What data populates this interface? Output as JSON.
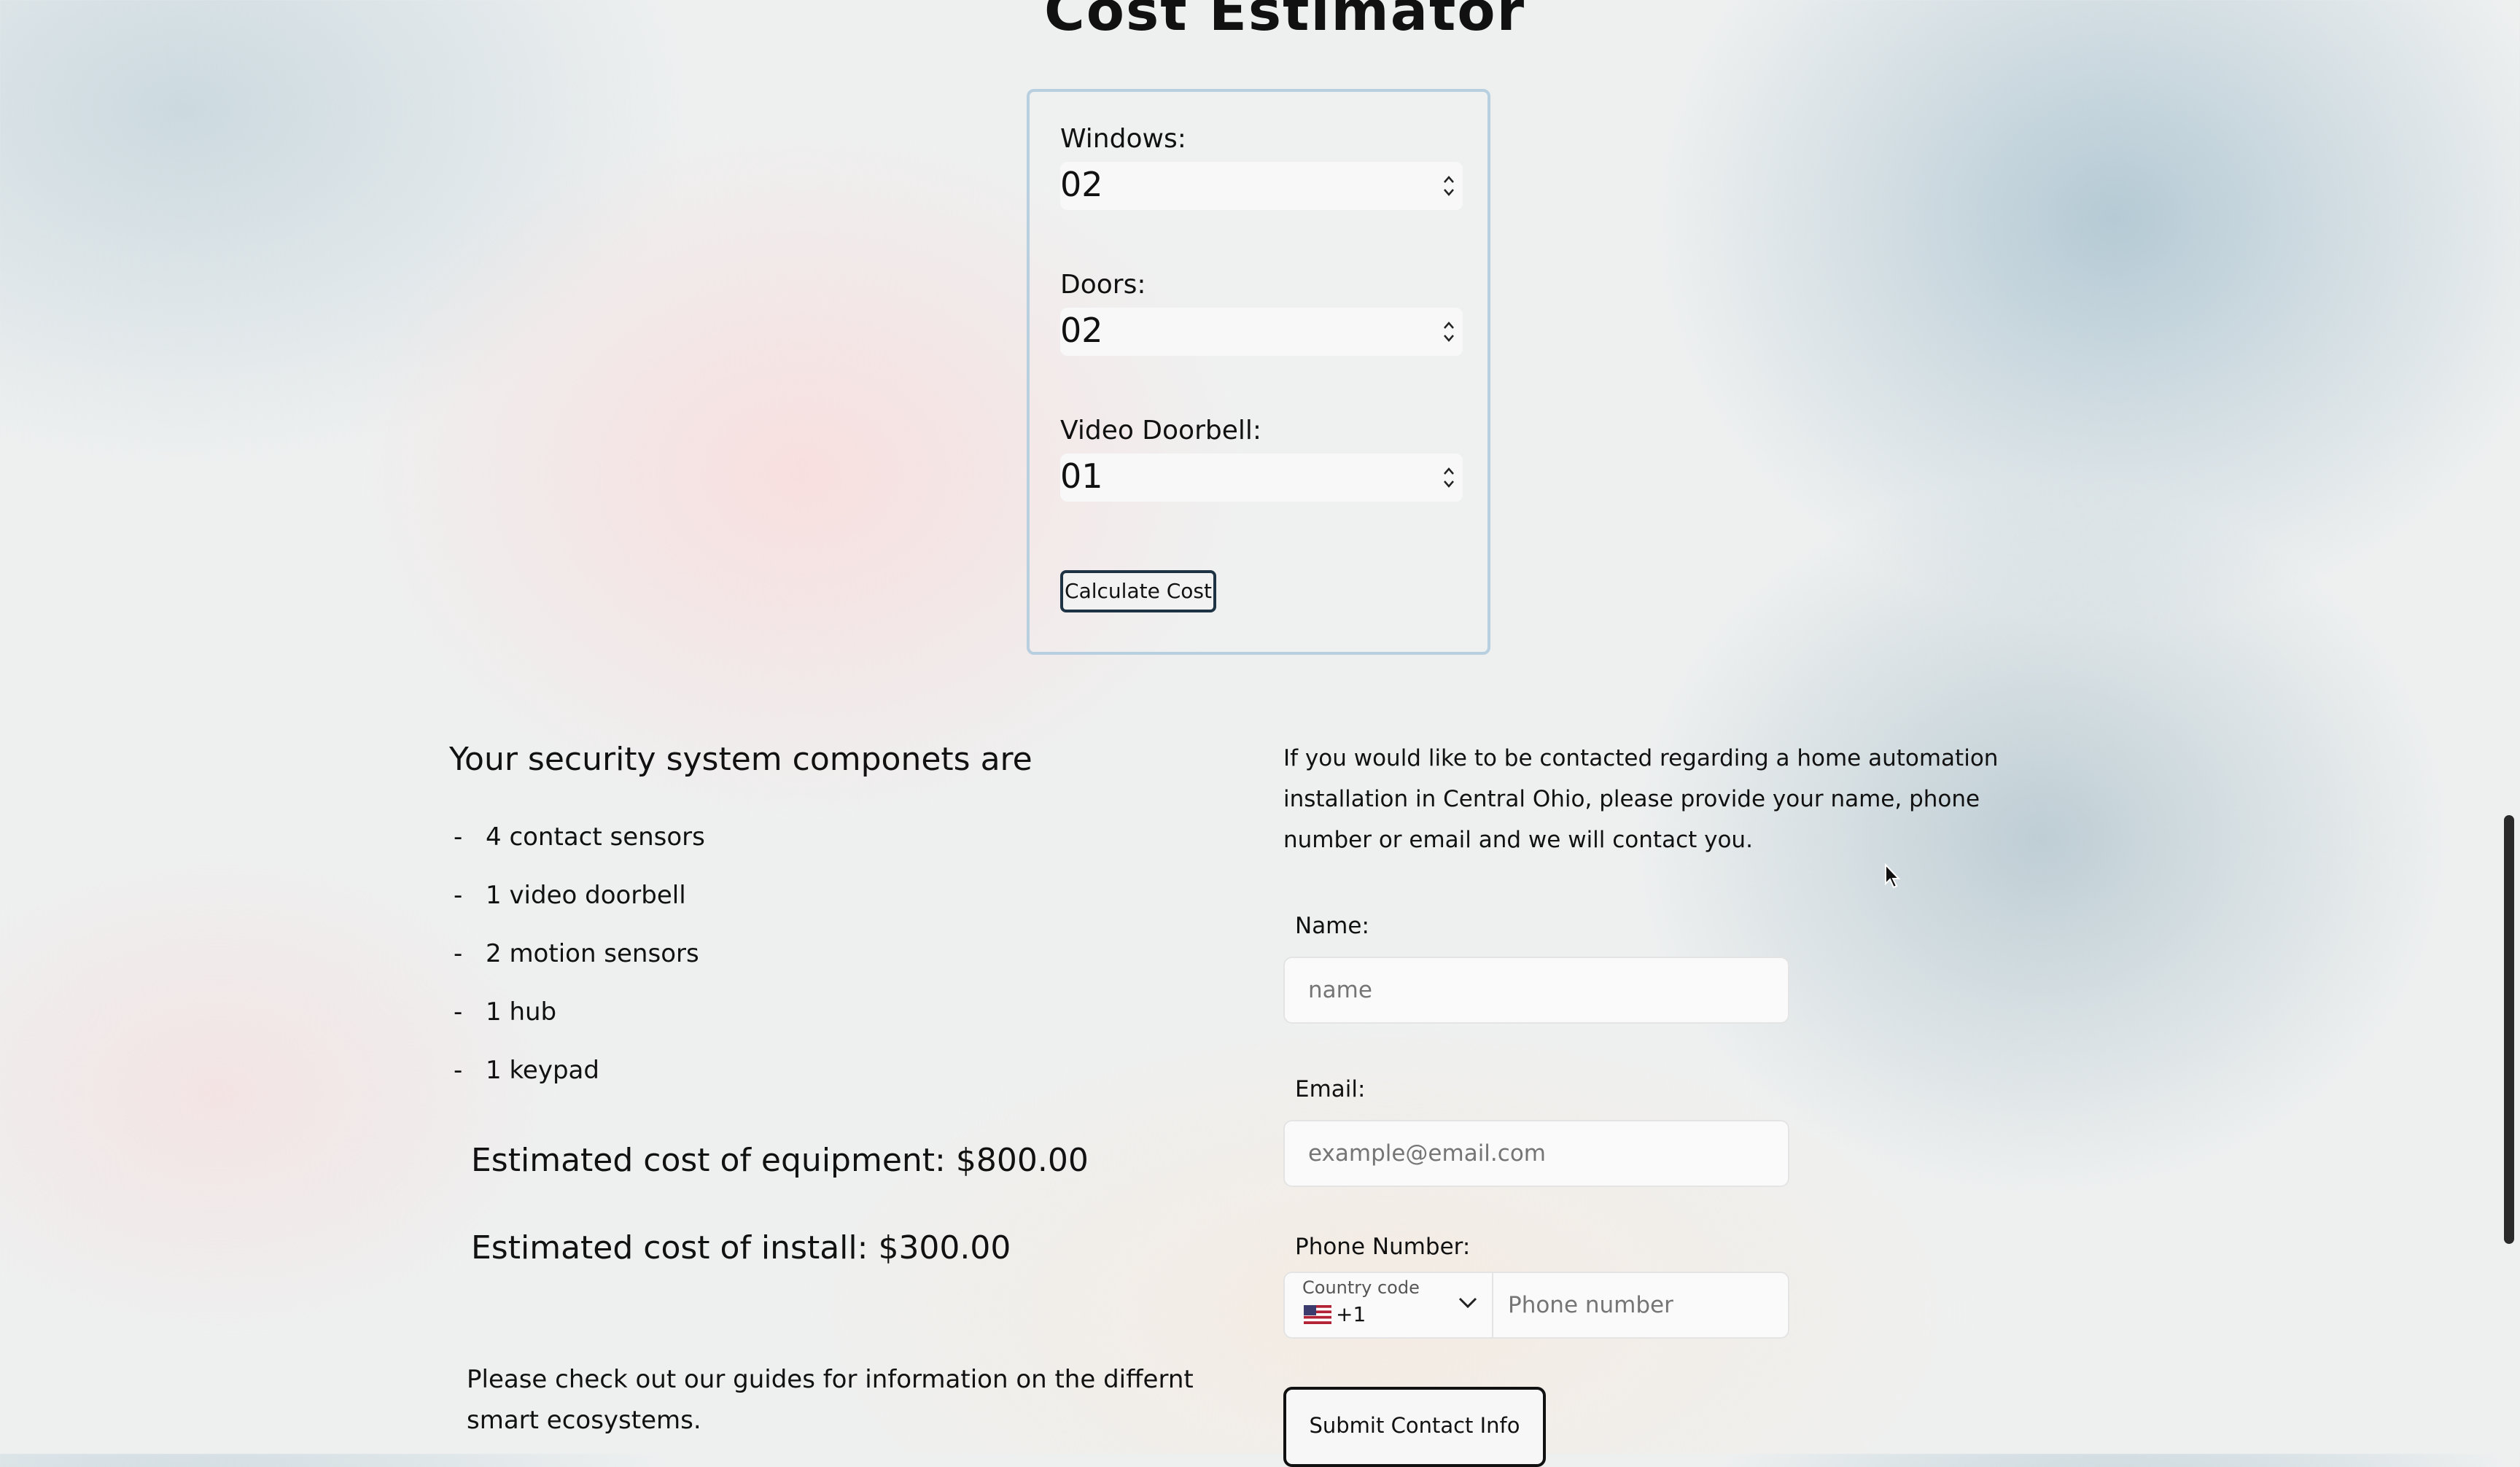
{
  "page": {
    "title": "Cost Estimator"
  },
  "estimator": {
    "windows_label": "Windows:",
    "windows_value": "02",
    "doors_label": "Doors:",
    "doors_value": "02",
    "doorbell_label": "Video Doorbell:",
    "doorbell_value": "01",
    "calculate_button": "Calculate Cost"
  },
  "results": {
    "heading": "Your security system componets are",
    "dash": "-",
    "components": [
      "4 contact sensors",
      "1 video doorbell",
      "2 motion sensors",
      "1 hub",
      "1 keypad"
    ],
    "equipment_cost": "Estimated cost of equipment: $800.00",
    "install_cost": "Estimated cost of install: $300.00",
    "guide_text": "Please check out our guides for information on the differnt smart ecosystems."
  },
  "contact": {
    "intro": "If you would like to be contacted regarding a home automation installation in Central Ohio, please provide your name, phone number or email and we will contact you.",
    "name_label": "Name:",
    "name_placeholder": "name",
    "email_label": "Email:",
    "email_placeholder": "example@email.com",
    "phone_label": "Phone Number:",
    "country_caption": "Country code",
    "country_code": "+1",
    "phone_placeholder": "Phone number",
    "submit_button": "Submit Contact Info"
  },
  "icons": {
    "flag": "us-flag-icon",
    "chevron": "chevron-down-icon",
    "spinner": "spinner-arrows-icon",
    "cursor": "mouse-cursor-icon"
  }
}
